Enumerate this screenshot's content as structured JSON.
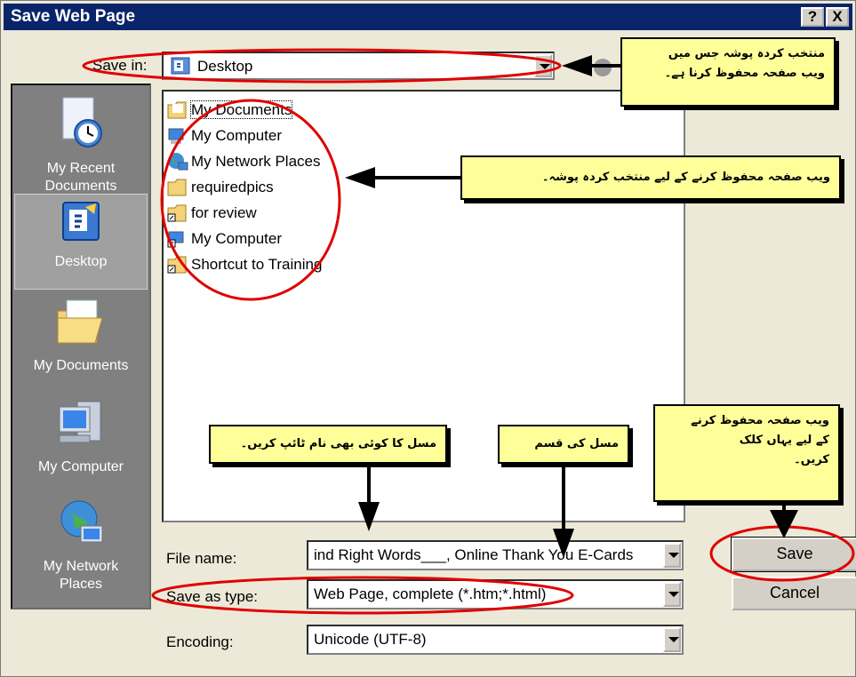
{
  "window": {
    "title": "Save Web Page",
    "help_button": "?",
    "close_button": "X"
  },
  "save_in": {
    "label": "Save in:",
    "value": "Desktop",
    "icon": "desktop-icon"
  },
  "places_bar": [
    {
      "label_line1": "My Recent",
      "label_line2": "Documents",
      "icon": "recent-documents-icon"
    },
    {
      "label_line1": "Desktop",
      "label_line2": "",
      "icon": "desktop-icon",
      "selected": true
    },
    {
      "label_line1": "My Documents",
      "label_line2": "",
      "icon": "my-documents-icon"
    },
    {
      "label_line1": "My Computer",
      "label_line2": "",
      "icon": "my-computer-icon"
    },
    {
      "label_line1": "My Network",
      "label_line2": "Places",
      "icon": "network-places-icon"
    }
  ],
  "files": [
    {
      "name": "My Documents",
      "icon": "my-documents-icon"
    },
    {
      "name": "My Computer",
      "icon": "my-computer-icon"
    },
    {
      "name": "My Network Places",
      "icon": "network-places-icon"
    },
    {
      "name": "requiredpics",
      "icon": "folder-icon"
    },
    {
      "name": "for review",
      "icon": "shortcut-folder-icon"
    },
    {
      "name": "My Computer",
      "icon": "my-computer-shortcut-icon"
    },
    {
      "name": "Shortcut to Training",
      "icon": "shortcut-folder-icon"
    }
  ],
  "form": {
    "file_name_label": "File name:",
    "file_name_value": "ind Right Words___, Online Thank You E-Cards",
    "save_as_type_label": "Save as type:",
    "save_as_type_value": "Web Page, complete (*.htm;*.html)",
    "encoding_label": "Encoding:",
    "encoding_value": "Unicode (UTF-8)"
  },
  "buttons": {
    "save": "Save",
    "cancel": "Cancel"
  },
  "callouts": {
    "save_in_line1": "منتخب کردہ پوشہ جس میں",
    "save_in_line2": "ویب صفحہ محفوظ کرنا ہے۔",
    "folder": "ویب صفحہ محفوظ کرنے کے لیے منتخب کردہ پوشہ۔",
    "file_name": "مسل کا کوئی بھی نام ٹائپ کریں۔",
    "file_type": "مسل کی قسم",
    "save_line1": "ویب صفحہ محفوظ کرنے",
    "save_line2": "کے لیے یہاں کلک",
    "save_line3": "کریں۔"
  },
  "colors": {
    "titlebar": "#0a246a",
    "dialog_bg": "#ece9d8",
    "places_bg": "#808080",
    "callout_bg": "#ffff99",
    "highlight_ellipse": "#e00000"
  }
}
